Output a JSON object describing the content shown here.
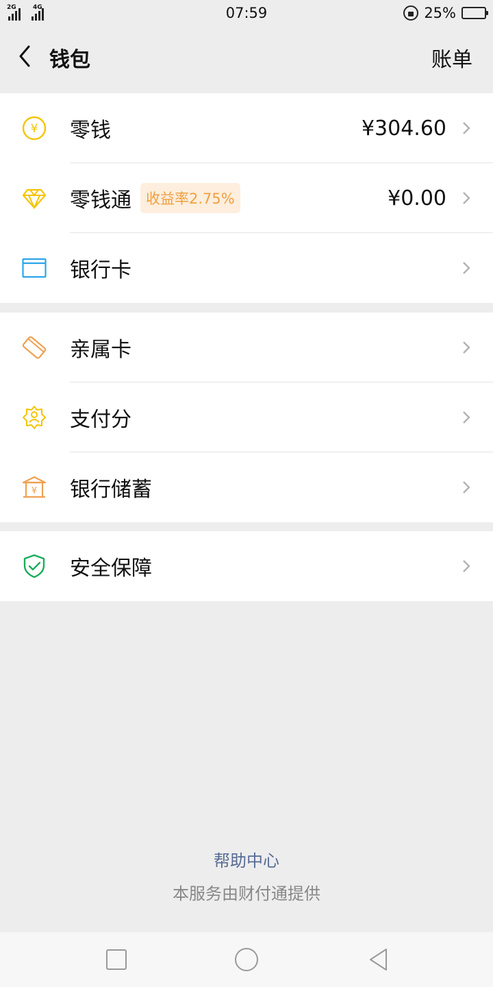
{
  "status_bar": {
    "net1": "2G",
    "net2": "4G",
    "time": "07:59",
    "battery": "25%",
    "battery_level": 0.25
  },
  "header": {
    "title": "钱包",
    "bill_label": "账单"
  },
  "section1": [
    {
      "label": "零钱",
      "value": "¥304.60",
      "icon": "yuan-coin-icon",
      "color": "#f5c400"
    },
    {
      "label": "零钱通",
      "badge": "收益率2.75%",
      "value": "¥0.00",
      "icon": "diamond-icon",
      "color": "#f5c400"
    },
    {
      "label": "银行卡",
      "icon": "bank-card-icon",
      "color": "#2aa6e8"
    }
  ],
  "section2": [
    {
      "label": "亲属卡",
      "icon": "family-card-icon",
      "color": "#f0a050"
    },
    {
      "label": "支付分",
      "icon": "credit-score-icon",
      "color": "#f5c400"
    },
    {
      "label": "银行储蓄",
      "icon": "bank-savings-icon",
      "color": "#f0a050"
    }
  ],
  "section3": [
    {
      "label": "安全保障",
      "icon": "shield-check-icon",
      "color": "#1aad5a"
    }
  ],
  "footer": {
    "help": "帮助中心",
    "provider": "本服务由财付通提供"
  },
  "colors": {
    "link": "#576b95",
    "badge_bg": "#fdeedd",
    "badge_text": "#f0a040",
    "battery_fill": "#2ed573"
  }
}
